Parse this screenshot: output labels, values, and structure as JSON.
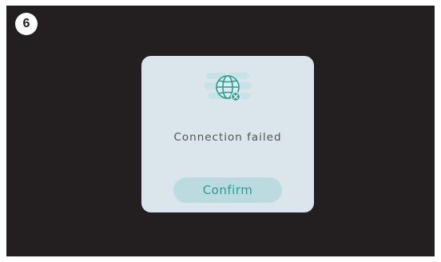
{
  "step": {
    "number": "6"
  },
  "dialog": {
    "icon": "globe-disconnected-icon",
    "message": "Connection failed",
    "confirm_label": "Confirm"
  },
  "colors": {
    "screen_background": "#231f20",
    "dialog_background": "#dbe6ec",
    "button_background": "#bcdbe0",
    "accent": "#2f9a94",
    "text": "#4e5458"
  }
}
